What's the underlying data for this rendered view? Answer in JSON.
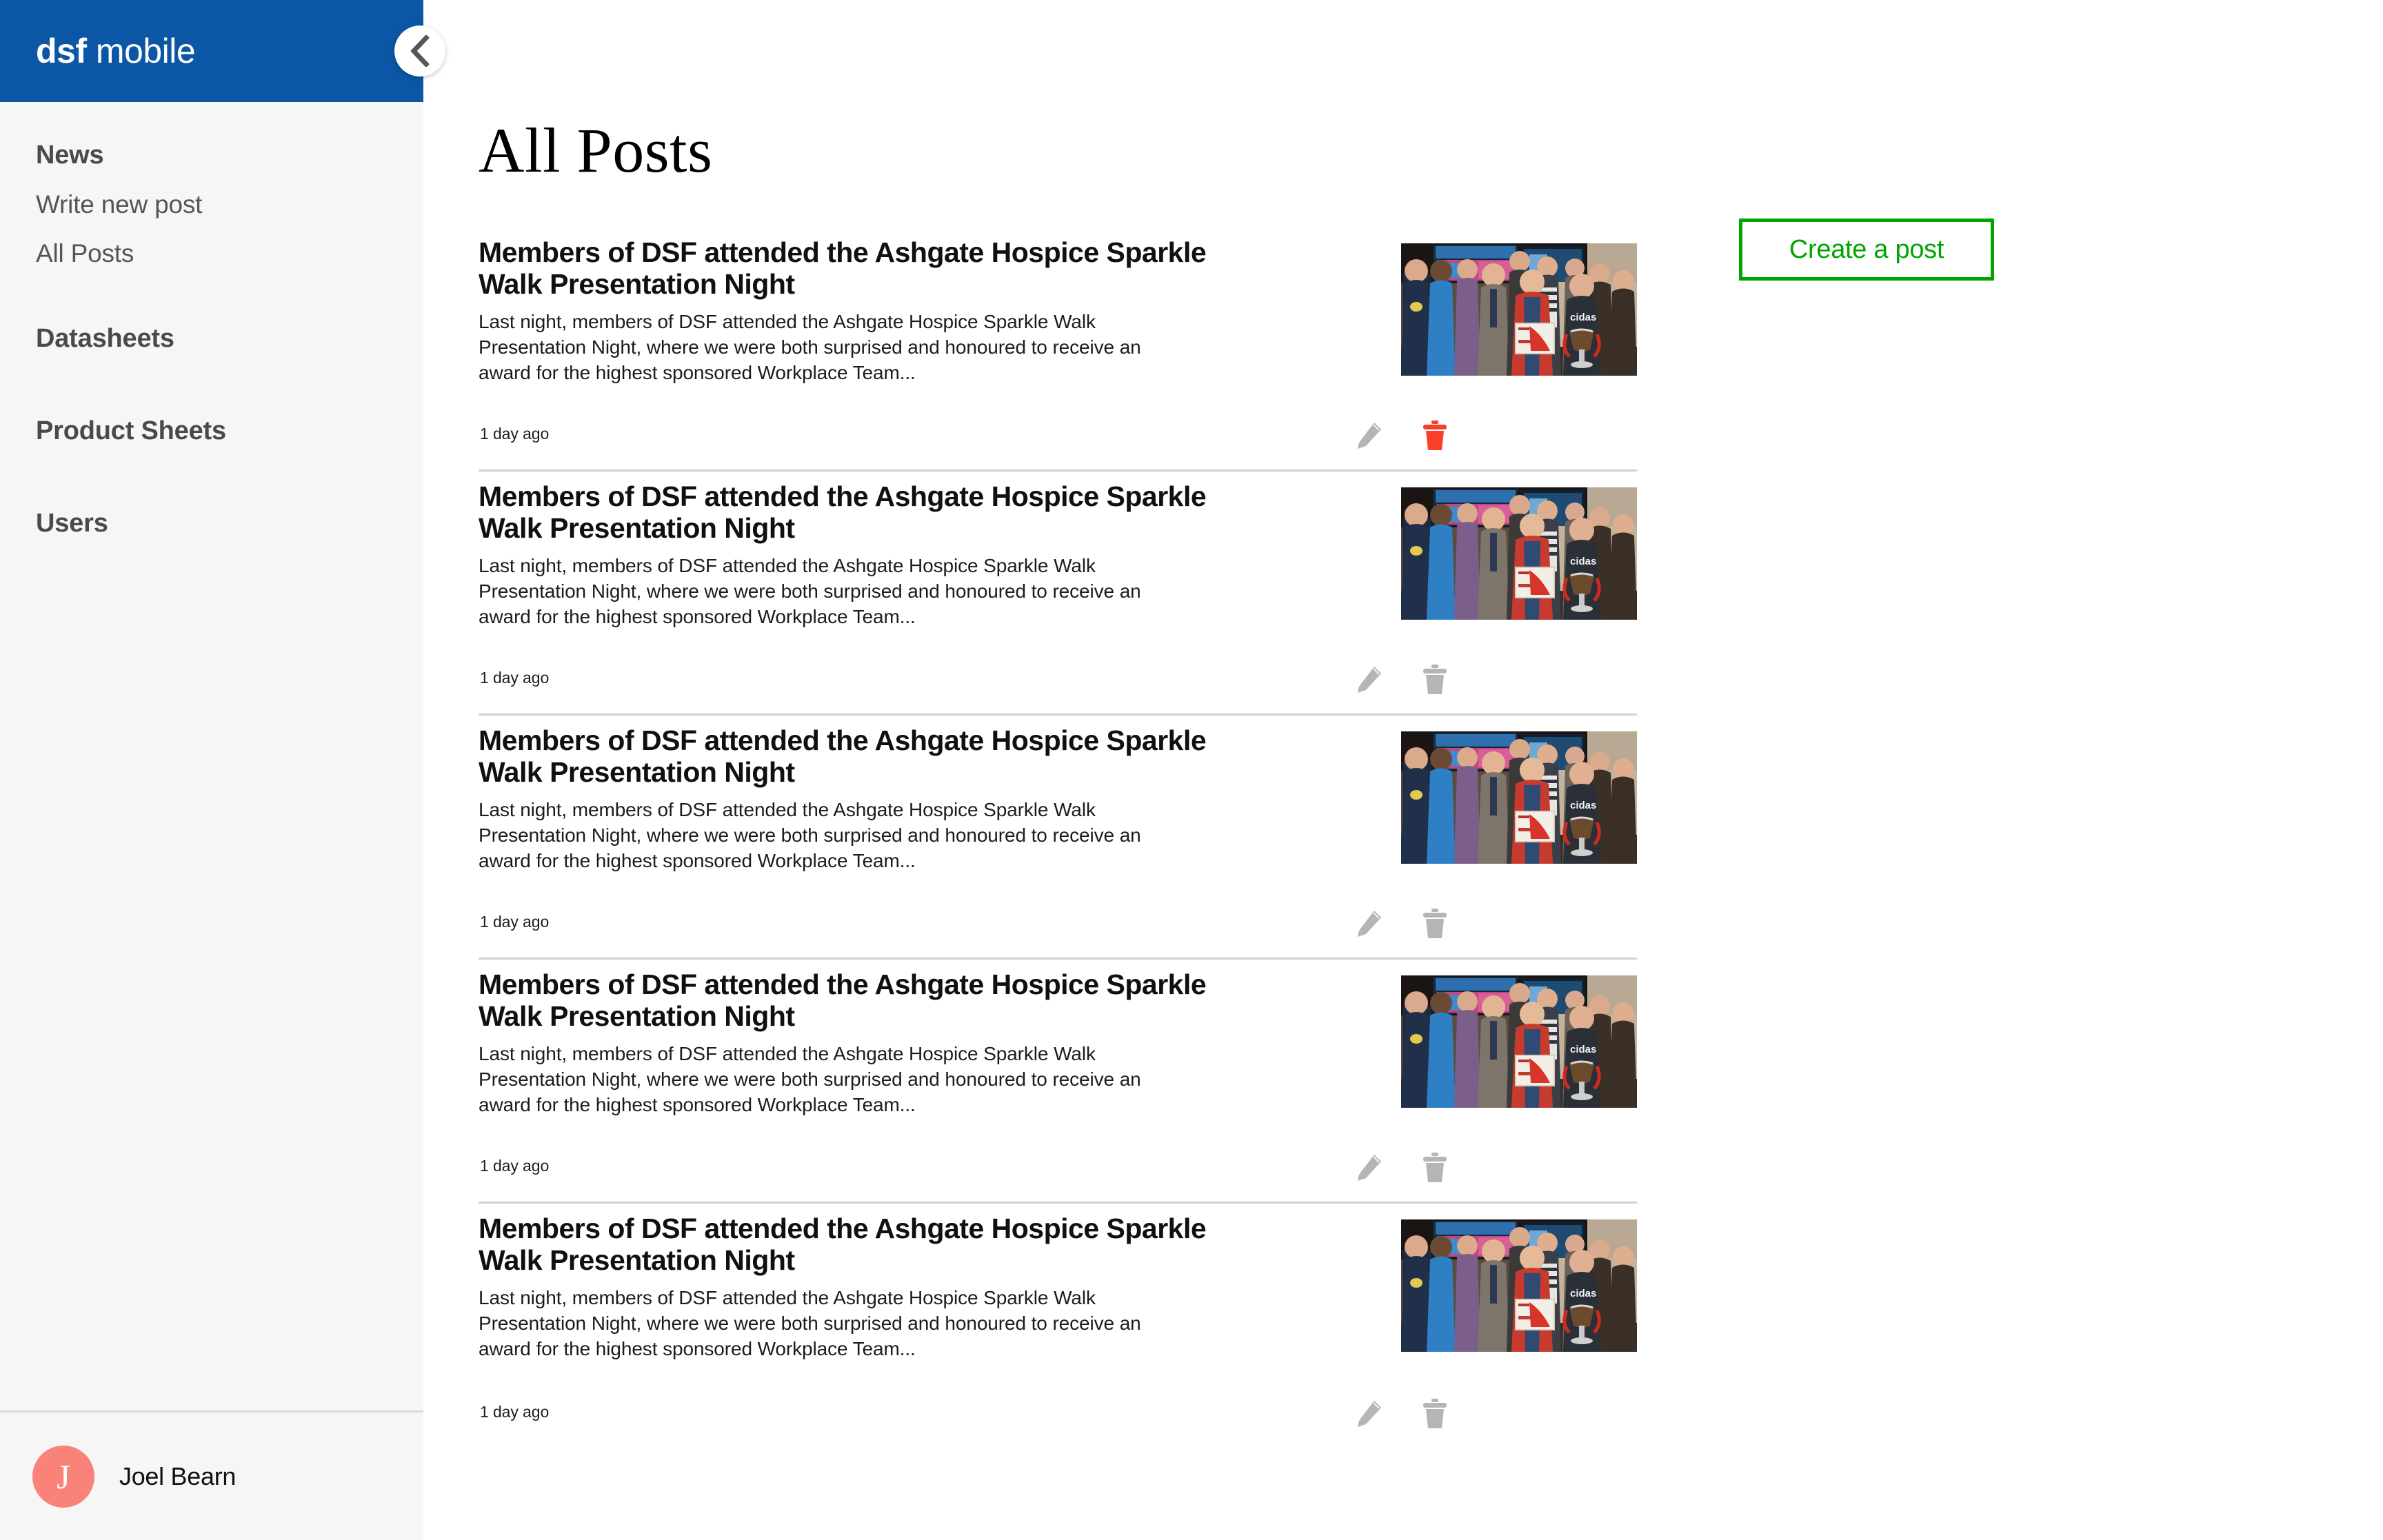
{
  "brand": {
    "name_bold": "dsf",
    "name_light": "mobile",
    "collapse_icon": "chevron-left-icon"
  },
  "sidebar": {
    "sections": [
      {
        "label": "News",
        "items": [
          {
            "label": "Write new post"
          },
          {
            "label": "All Posts"
          }
        ]
      },
      {
        "label": "Datasheets",
        "items": []
      },
      {
        "label": "Product Sheets",
        "items": []
      },
      {
        "label": "Users",
        "items": []
      }
    ],
    "user": {
      "initial": "J",
      "name": "Joel Bearn",
      "avatar_color": "#f98379"
    }
  },
  "main": {
    "page_title": "All Posts",
    "create_button": {
      "label": "Create a post",
      "color": "#00a500"
    },
    "posts": [
      {
        "title": "Members of DSF attended the Ashgate Hospice Sparkle Walk Presentation Night",
        "excerpt": "Last night, members of DSF attended the Ashgate Hospice Sparkle Walk Presentation Night, where we were both surprised and honoured to receive an award for the highest sponsored Workplace Team...",
        "timestamp": "1 day ago",
        "edit_icon": "pencil-icon",
        "delete_icon": "trash-icon",
        "delete_color": "#fa3f28",
        "edit_color": "#b5b5b5",
        "thumbnail_alt": "group-photo-award-presentation"
      },
      {
        "title": "Members of DSF attended the Ashgate Hospice Sparkle Walk Presentation Night",
        "excerpt": "Last night, members of DSF attended the Ashgate Hospice Sparkle Walk Presentation Night, where we were both surprised and honoured to receive an award for the highest sponsored Workplace Team...",
        "timestamp": "1 day ago",
        "edit_icon": "pencil-icon",
        "delete_icon": "trash-icon",
        "delete_color": "#b5b5b5",
        "edit_color": "#b5b5b5",
        "thumbnail_alt": "group-photo-award-presentation"
      },
      {
        "title": "Members of DSF attended the Ashgate Hospice Sparkle Walk Presentation Night",
        "excerpt": "Last night, members of DSF attended the Ashgate Hospice Sparkle Walk Presentation Night, where we were both surprised and honoured to receive an award for the highest sponsored Workplace Team...",
        "timestamp": "1 day ago",
        "edit_icon": "pencil-icon",
        "delete_icon": "trash-icon",
        "delete_color": "#b5b5b5",
        "edit_color": "#b5b5b5",
        "thumbnail_alt": "group-photo-award-presentation"
      },
      {
        "title": "Members of DSF attended the Ashgate Hospice Sparkle Walk Presentation Night",
        "excerpt": "Last night, members of DSF attended the Ashgate Hospice Sparkle Walk Presentation Night, where we were both surprised and honoured to receive an award for the highest sponsored Workplace Team...",
        "timestamp": "1 day ago",
        "edit_icon": "pencil-icon",
        "delete_icon": "trash-icon",
        "delete_color": "#b5b5b5",
        "edit_color": "#b5b5b5",
        "thumbnail_alt": "group-photo-award-presentation"
      },
      {
        "title": "Members of DSF attended the Ashgate Hospice Sparkle Walk Presentation Night",
        "excerpt": "Last night, members of DSF attended the Ashgate Hospice Sparkle Walk Presentation Night, where we were both surprised and honoured to receive an award for the highest sponsored Workplace Team...",
        "timestamp": "1 day ago",
        "edit_icon": "pencil-icon",
        "delete_icon": "trash-icon",
        "delete_color": "#b5b5b5",
        "edit_color": "#b5b5b5",
        "thumbnail_alt": "group-photo-award-presentation"
      }
    ]
  },
  "colors": {
    "brand_blue": "#0b57a5",
    "sidebar_bg": "#f6f6f6",
    "accent_green": "#00a500",
    "danger_red": "#fa3f28"
  }
}
